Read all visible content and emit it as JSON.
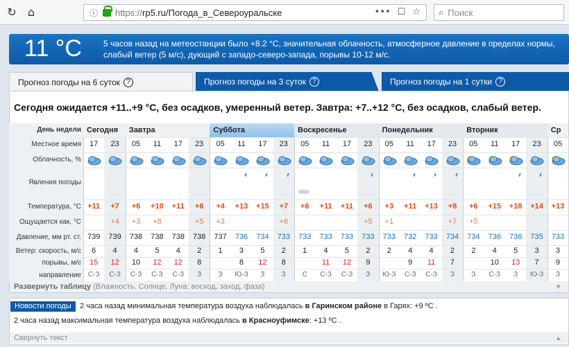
{
  "browser": {
    "url_proto": "https://",
    "url_rest": "rp5.ru/Погода_в_Североуральске",
    "search_placeholder": "Поиск"
  },
  "banner": {
    "temperature": "11 °C",
    "message": "5 часов назад на метеостанции было +8.2 °C, значительная облачность, атмосферное давление в пределах нормы, слабый ветер (5 м/с), дующий с западо-северо-запада, порывы 10-12 м/с."
  },
  "tabs": [
    {
      "label": "Прогноз погоды на 6 суток",
      "q": "?"
    },
    {
      "label": "Прогноз погоды на 3 суток",
      "q": "?"
    },
    {
      "label": "Прогноз погоды на 1 сутки",
      "q": "?"
    }
  ],
  "headline": "Сегодня ожидается +11..+9 °С, без осадков, умеренный ветер. Завтра: +7..+12 °С, без осадков, слабый ветер.",
  "row_labels": {
    "day": "День недели",
    "time": "Местное время",
    "cloud": "Облачность, %",
    "phen": "Явления погоды",
    "temp": "Температура, °C",
    "feels": "Ощущается как, °C",
    "press": "Давление, мм рт. ст.",
    "wind": "Ветер: скорость, м/с",
    "gust": "порывы, м/с",
    "dir": "направление"
  },
  "days": [
    "Сегодня",
    "Завтра",
    "Суббота",
    "Воскресенье",
    "Понедельник",
    "Вторник",
    "Ср"
  ],
  "columns": [
    {
      "time": "17",
      "temp": "+11",
      "feels": "",
      "press": "739",
      "wind": "6",
      "gust": "15",
      "dir": "С-З"
    },
    {
      "time": "23",
      "temp": "+7",
      "feels": "+4",
      "press": "739",
      "wind": "4",
      "gust": "12",
      "dir": "С-З"
    },
    {
      "time": "05",
      "temp": "+6",
      "feels": "+3",
      "press": "738",
      "wind": "4",
      "gust": "10",
      "dir": "С-З"
    },
    {
      "time": "11",
      "temp": "+10",
      "feels": "+8",
      "press": "738",
      "wind": "5",
      "gust": "12",
      "dir": "С-З"
    },
    {
      "time": "17",
      "temp": "+11",
      "feels": "",
      "press": "738",
      "wind": "4",
      "gust": "12",
      "dir": "С-З"
    },
    {
      "time": "23",
      "temp": "+6",
      "feels": "+5",
      "press": "738",
      "wind": "2",
      "gust": "8",
      "dir": "З"
    },
    {
      "time": "05",
      "temp": "+4",
      "feels": "+3",
      "press": "737",
      "wind": "1",
      "gust": "",
      "dir": "З"
    },
    {
      "time": "11",
      "temp": "+13",
      "feels": "",
      "press": "736",
      "wind": "3",
      "gust": "8",
      "dir": "Ю-З"
    },
    {
      "time": "17",
      "temp": "+15",
      "feels": "",
      "press": "734",
      "wind": "5",
      "gust": "12",
      "dir": "З"
    },
    {
      "time": "23",
      "temp": "+7",
      "feels": "+6",
      "press": "733",
      "wind": "2",
      "gust": "8",
      "dir": "З"
    },
    {
      "time": "05",
      "temp": "+6",
      "feels": "",
      "press": "733",
      "wind": "1",
      "gust": "",
      "dir": "С"
    },
    {
      "time": "11",
      "temp": "+11",
      "feels": "",
      "press": "733",
      "wind": "4",
      "gust": "11",
      "dir": "С-З"
    },
    {
      "time": "17",
      "temp": "+11",
      "feels": "",
      "press": "733",
      "wind": "5",
      "gust": "12",
      "dir": "С-З"
    },
    {
      "time": "23",
      "temp": "+6",
      "feels": "+5",
      "press": "733",
      "wind": "2",
      "gust": "9",
      "dir": "З"
    },
    {
      "time": "05",
      "temp": "+3",
      "feels": "+1",
      "press": "733",
      "wind": "2",
      "gust": "",
      "dir": "Ю-З"
    },
    {
      "time": "11",
      "temp": "+11",
      "feels": "",
      "press": "732",
      "wind": "4",
      "gust": "9",
      "dir": "С-З"
    },
    {
      "time": "17",
      "temp": "+13",
      "feels": "",
      "press": "733",
      "wind": "4",
      "gust": "11",
      "dir": "С-З"
    },
    {
      "time": "23",
      "temp": "+8",
      "feels": "+7",
      "press": "734",
      "wind": "2",
      "gust": "7",
      "dir": "З"
    },
    {
      "time": "05",
      "temp": "+6",
      "feels": "+5",
      "press": "734",
      "wind": "2",
      "gust": "",
      "dir": "З"
    },
    {
      "time": "11",
      "temp": "+15",
      "feels": "",
      "press": "736",
      "wind": "4",
      "gust": "10",
      "dir": "С-З"
    },
    {
      "time": "17",
      "temp": "+18",
      "feels": "",
      "press": "736",
      "wind": "5",
      "gust": "13",
      "dir": "З"
    },
    {
      "time": "23",
      "temp": "+14",
      "feels": "",
      "press": "735",
      "wind": "3",
      "gust": "7",
      "dir": "Ю-З"
    },
    {
      "time": "05",
      "temp": "+13",
      "feels": "",
      "press": "733",
      "wind": "3",
      "gust": "9",
      "dir": "З"
    }
  ],
  "expand_label": "Развернуть таблицу",
  "expand_note": "(Влажность. Солнце, Луна: восход, заход, фаза)",
  "news": {
    "button": "Новости погоды",
    "item1_pre": "2 часа назад минимальная температура воздуха наблюдалась ",
    "item1_bold": "в Гаринском районе",
    "item1_post": " в Гарях: +9 ºС .",
    "item2_pre": "2 часа назад максимальная температура воздуха наблюдалась ",
    "item2_bold": "в Красноуфимске",
    "item2_post": ": +13 ºС ."
  },
  "collapse_label": "Свернуть текст",
  "colors": {
    "accent": "#0d5aa8",
    "temp": "#e8470c",
    "pressure": "#1e6fb5",
    "gust": "#e02020"
  }
}
